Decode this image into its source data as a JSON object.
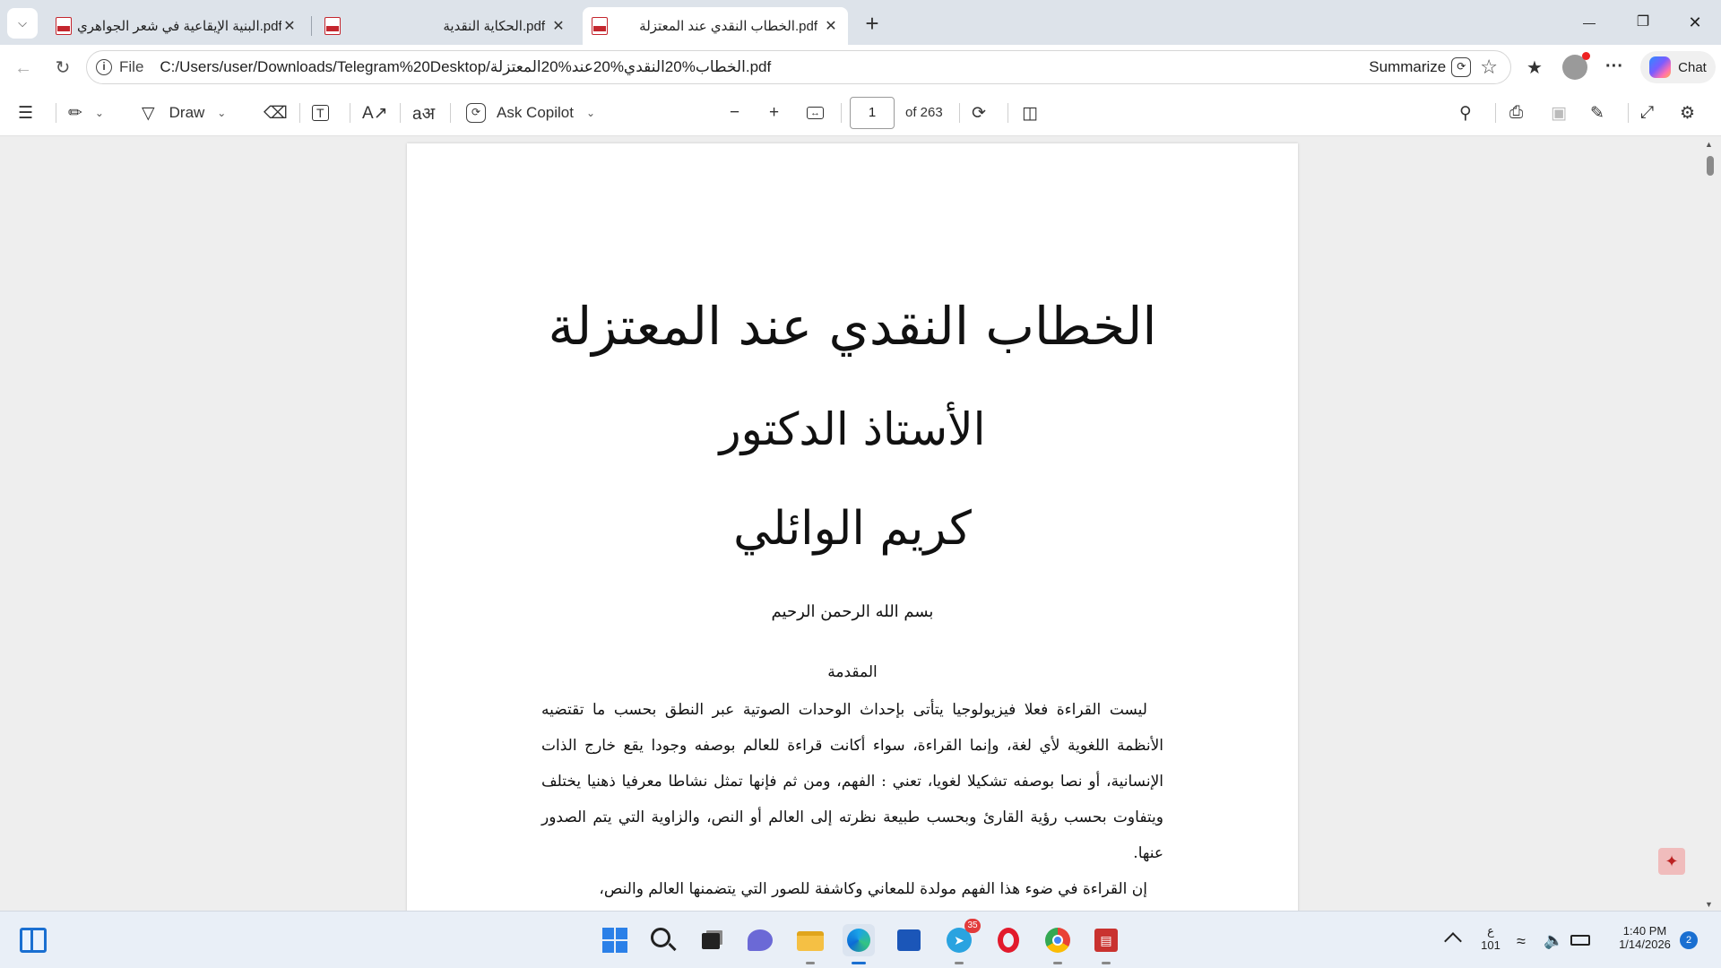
{
  "tabs": [
    {
      "title": "البنية الإيقاعية في شعر الجواهري.pdf",
      "active": false
    },
    {
      "title": "الحكاية النقدية.pdf",
      "active": false
    },
    {
      "title": "الخطاب النقدي عند المعتزلة.pdf",
      "active": true
    }
  ],
  "tab_close_glyph": "✕",
  "new_tab_glyph": "+",
  "window": {
    "minimize": "—",
    "restore": "❐",
    "close": "✕"
  },
  "address": {
    "scheme": "File",
    "url": "C:/Users/user/Downloads/Telegram%20Desktop/الخطاب%20النقدي%20عند%20المعتزلة.pdf",
    "summarize": "Summarize"
  },
  "chat_label": "Chat",
  "pdf_toolbar": {
    "draw_label": "Draw",
    "ask_copilot_label": "Ask Copilot",
    "current_page": "1",
    "total_pages": "of 263"
  },
  "document": {
    "title": "الخطاب النقدي عند المعتزلة",
    "author_prefix": "الأستاذ الدكتور",
    "author_name": "كريم الوائلي",
    "basmala": "بسم الله الرحمن الرحيم",
    "section": "المقدمة",
    "paragraphs": [
      "ليست القراءة فعلا فيزيولوجيا يتأتى بإحداث الوحدات الصوتية عبر النطق بحسب ما تقتضيه الأنظمة اللغوية لأي لغة، وإنما القراءة، سواء أكانت قراءة للعالم بوصفه وجودا يقع خارج الذات الإنسانية، أو نصا بوصفه تشكيلا لغويا، تعني : الفهم، ومن ثم فإنها تمثل نشاطا معرفيا ذهنيا يختلف ويتفاوت بحسب رؤية القارئ وبحسب طبيعة نظرته إلى العالم أو النص، والزاوية التي يتم الصدور عنها.",
      "إن القراءة في ضوء هذا الفهم مولدة للمعاني وكاشفة للصور التي يتضمنها العالم والنص،"
    ]
  },
  "taskbar": {
    "telegram_badge": "35",
    "lang_top": "ع",
    "lang_bottom": "101",
    "time": "1:40 PM",
    "date": "1/14/2026",
    "notifications": "2"
  },
  "icons": {
    "tab_menu": "chevron-down-icon",
    "back": "arrow-left-icon",
    "refresh": "refresh-icon",
    "favorites": "favorites-icon",
    "more": "more-icon",
    "contents": "list-icon",
    "highlight": "highlighter-icon",
    "erase": "eraser-icon",
    "text": "text-box-icon",
    "read_aloud": "read-aloud-icon",
    "translate": "translate-icon",
    "zoom_out": "minus-icon",
    "zoom_in": "plus-icon",
    "fit": "fit-width-icon",
    "rotate": "rotate-icon",
    "view": "page-view-icon",
    "search": "search-icon",
    "print": "print-icon",
    "save": "save-icon",
    "save_as": "save-as-icon",
    "fullscreen": "fullscreen-icon",
    "settings": "gear-icon"
  },
  "colors": {
    "pdf_red": "#c4262e",
    "tab_strip": "#dde3ea",
    "viewer_bg": "#eeeeee"
  }
}
